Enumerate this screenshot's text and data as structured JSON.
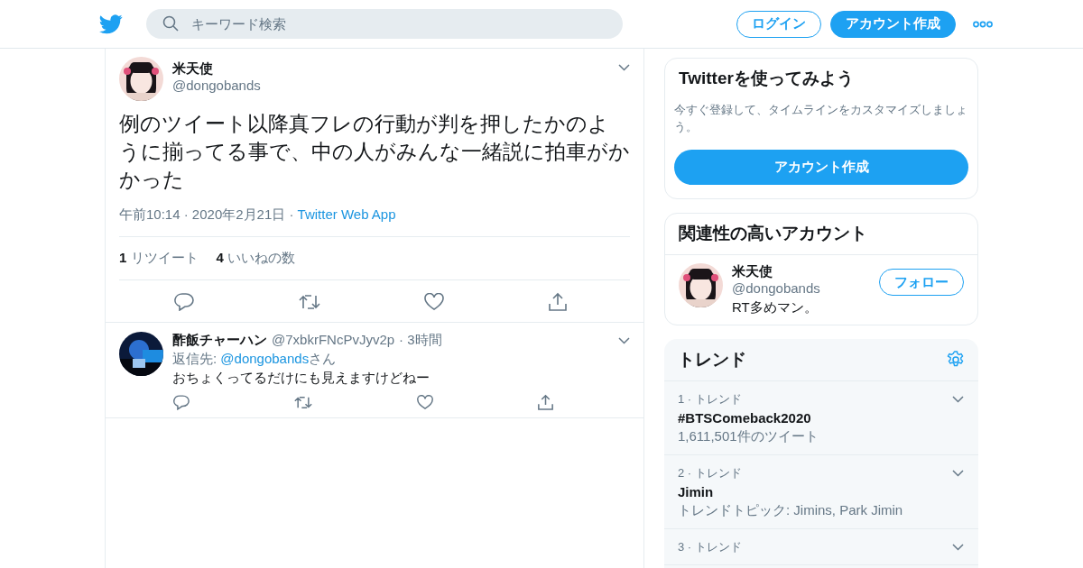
{
  "header": {
    "search": {
      "placeholder": "キーワード検索"
    },
    "login": "ログイン",
    "signup": "アカウント作成"
  },
  "tweet": {
    "name": "米天使",
    "handle": "@dongobands",
    "text": "例のツイート以降真フレの行動が判を押したかのように揃ってる事で、中の人がみんな一緒説に拍車がかかった",
    "timestamp": "午前10:14 · 2020年2月21日 · ",
    "source": "Twitter Web App",
    "stats": [
      {
        "count": "1",
        "label": "リツイート"
      },
      {
        "count": "4",
        "label": "いいねの数"
      }
    ]
  },
  "replies": [
    {
      "name": "酢飯チャーハン",
      "handle": "@7xbkrFNcPvJyv2p",
      "time": "· 3時間",
      "reply_prefix": "返信先: ",
      "mention": "@dongobands",
      "reply_suffix": "さん",
      "text": "おちょくってるだけにも見えますけどねー"
    }
  ],
  "sidebar": {
    "signup_card": {
      "title": "Twitterを使ってみよう",
      "description": "今すぐ登録して、タイムラインをカスタマイズしましょう。",
      "button": "アカウント作成"
    },
    "related": {
      "title": "関連性の高いアカウント",
      "accounts": [
        {
          "name": "米天使",
          "handle": "@dongobands",
          "bio": "RT多めマン。",
          "button": "フォロー"
        }
      ]
    },
    "trends": {
      "title": "トレンド",
      "items": [
        {
          "rank": "1 · トレンド",
          "name": "#BTSComeback2020",
          "meta": "1,611,501件のツイート"
        },
        {
          "rank": "2 · トレンド",
          "name": "Jimin",
          "meta": "トレンドトピック: Jimins, Park Jimin"
        },
        {
          "rank": "3 · トレンド"
        }
      ]
    }
  }
}
